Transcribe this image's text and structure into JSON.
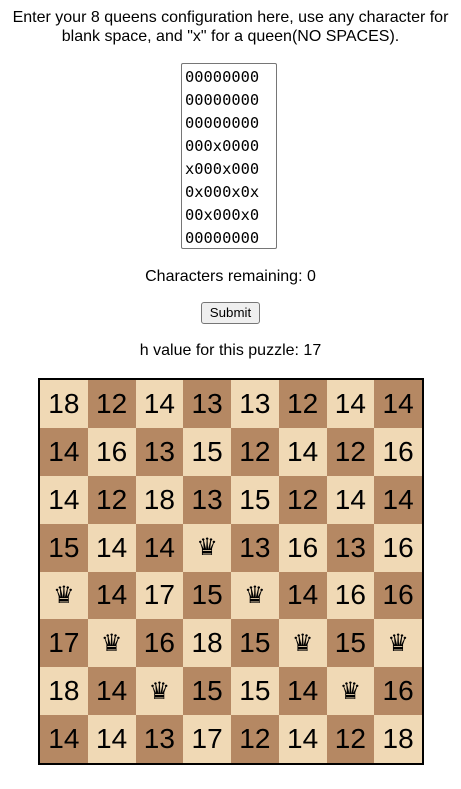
{
  "instructions": {
    "line1": "Enter your 8 queens configuration here, use any character for",
    "line2": "blank space, and \"x\" for a queen(NO SPACES)."
  },
  "config_input": {
    "value": "00000000\n00000000\n00000000\n000x0000\nx000x000\n0x000x0x\n00x000x0\n00000000"
  },
  "characters_remaining": {
    "label": "Characters remaining: 0"
  },
  "submit_button": {
    "label": "Submit"
  },
  "h_value": {
    "label": "h value for this puzzle: 17"
  },
  "queen_symbol": "♛",
  "board": {
    "light_color": "#f0d9b5",
    "dark_color": "#b58863",
    "rows": [
      [
        "18",
        "12",
        "14",
        "13",
        "13",
        "12",
        "14",
        "14"
      ],
      [
        "14",
        "16",
        "13",
        "15",
        "12",
        "14",
        "12",
        "16"
      ],
      [
        "14",
        "12",
        "18",
        "13",
        "15",
        "12",
        "14",
        "14"
      ],
      [
        "15",
        "14",
        "14",
        "Q",
        "13",
        "16",
        "13",
        "16"
      ],
      [
        "Q",
        "14",
        "17",
        "15",
        "Q",
        "14",
        "16",
        "16"
      ],
      [
        "17",
        "Q",
        "16",
        "18",
        "15",
        "Q",
        "15",
        "Q"
      ],
      [
        "18",
        "14",
        "Q",
        "15",
        "15",
        "14",
        "Q",
        "16"
      ],
      [
        "14",
        "14",
        "13",
        "17",
        "12",
        "14",
        "12",
        "18"
      ]
    ]
  }
}
